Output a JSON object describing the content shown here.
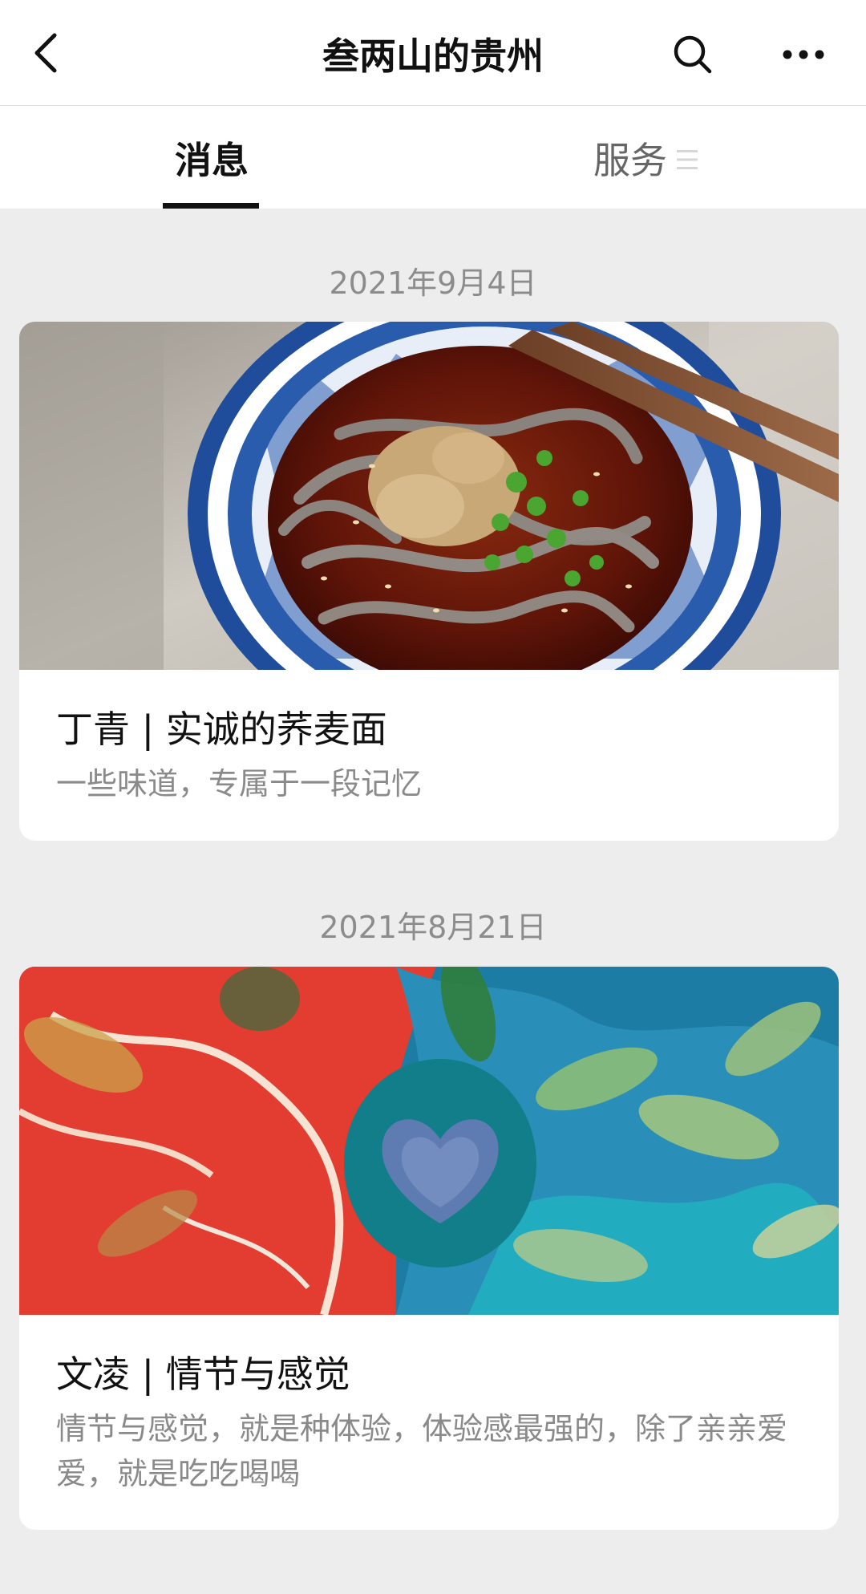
{
  "header": {
    "title": "叁两山的贵州",
    "back_icon": "chevron-left-icon",
    "search_icon": "search-icon",
    "more_icon": "more-horizontal-icon"
  },
  "tabs": [
    {
      "label": "消息",
      "active": true
    },
    {
      "label": "服务",
      "active": false,
      "icon": "menu-icon"
    }
  ],
  "feed": [
    {
      "date": "2021年9月4日",
      "title": "丁青 | 实诚的荞麦面",
      "description": "一些味道，专属于一段记忆",
      "image": "buckwheat-noodle-bowl-photo"
    },
    {
      "date": "2021年8月21日",
      "title": "文凌 | 情节与感觉",
      "description": "情节与感觉，就是种体验，体验感最强的，除了亲亲爱爱，就是吃吃喝喝",
      "image": "abstract-heart-painting"
    }
  ],
  "colors": {
    "background": "#ededed",
    "card": "#ffffff",
    "title_text": "#111111",
    "date_text": "#8c8c8c",
    "desc_text": "#8a8a8a",
    "tab_active_underline": "#111111"
  }
}
